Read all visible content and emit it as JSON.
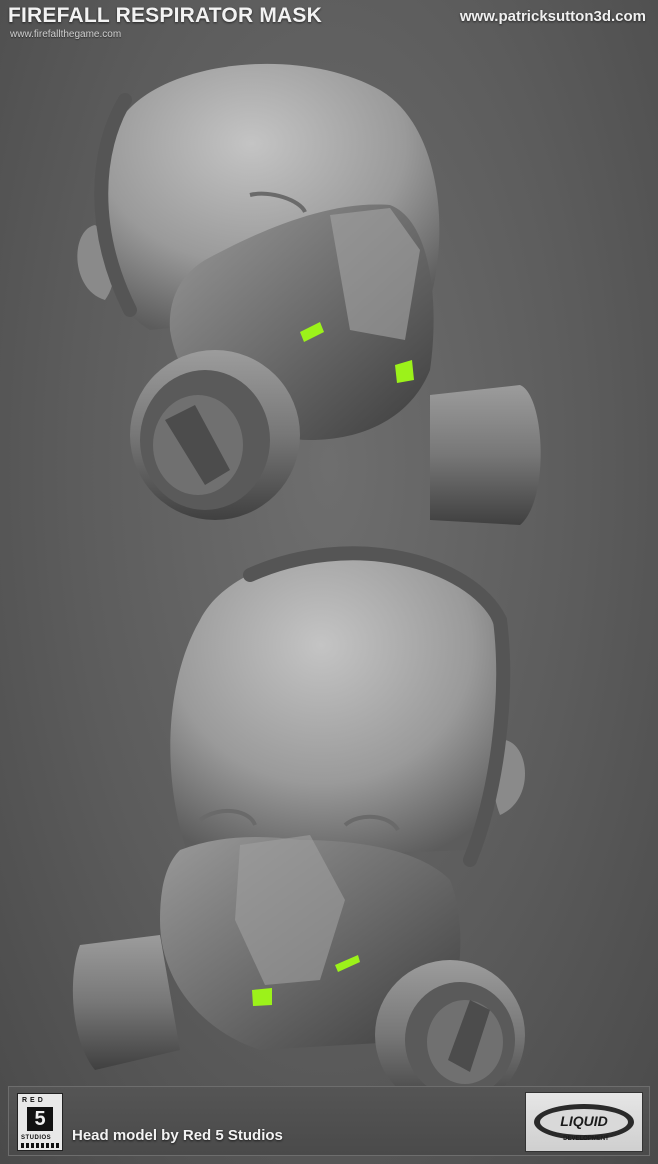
{
  "header": {
    "title": "FIREFALL RESPIRATOR MASK",
    "subtitle": "www.firefallthegame.com",
    "website": "www.patricksutton3d.com"
  },
  "footer": {
    "credit": "Head model by Red 5 Studios",
    "red5_logo": {
      "top_text": "RED",
      "number": "5",
      "bottom_text": "STUDIOS"
    },
    "liquid_logo": {
      "main_text": "LIQUID",
      "sub_text": "DEVELOPMENT"
    }
  },
  "colors": {
    "accent_green": "#9cf21a",
    "clay": "#8e8e8e",
    "background": "#5e5e5e"
  }
}
